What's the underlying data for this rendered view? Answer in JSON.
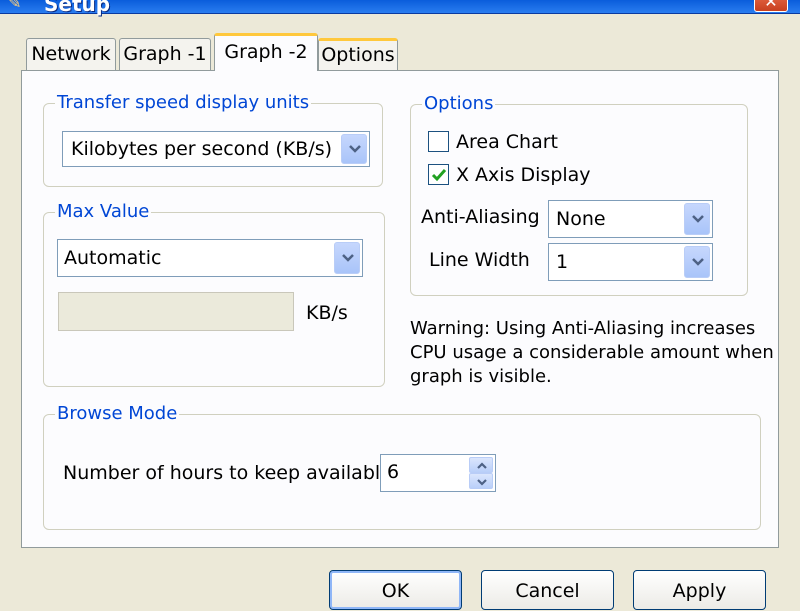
{
  "window": {
    "title": "Setup",
    "close_glyph": "✕",
    "app_icon": "app-icon"
  },
  "tabs": [
    {
      "label": "Network"
    },
    {
      "label": "Graph -1"
    },
    {
      "label": "Graph -2",
      "active": true
    },
    {
      "label": "Options"
    }
  ],
  "transfer_speed": {
    "group_label": "Transfer speed display units",
    "selected": "Kilobytes per second (KB/s)"
  },
  "max_value": {
    "group_label": "Max Value",
    "selected": "Automatic",
    "value": "",
    "unit": "KB/s"
  },
  "options": {
    "group_label": "Options",
    "area_chart": {
      "label": "Area Chart",
      "checked": false
    },
    "x_axis_display": {
      "label": "X Axis Display",
      "checked": true
    },
    "anti_aliasing": {
      "label": "Anti-Aliasing",
      "selected": "None"
    },
    "line_width": {
      "label": "Line Width",
      "selected": "1"
    }
  },
  "warning": {
    "line1": "Warning: Using Anti-Aliasing increases",
    "line2": "CPU usage a considerable amount when",
    "line3": "graph is visible."
  },
  "browse_mode": {
    "group_label": "Browse Mode",
    "hours_label": "Number of hours to keep available",
    "hours_value": "6"
  },
  "buttons": {
    "ok": "OK",
    "cancel": "Cancel",
    "apply": "Apply"
  },
  "colors": {
    "dialog_bg": "#ece9d8",
    "panel_bg": "#fcfcfe",
    "group_label": "#0046d5",
    "tab_highlight": "#ffc83c",
    "check_mark": "#21a121"
  }
}
